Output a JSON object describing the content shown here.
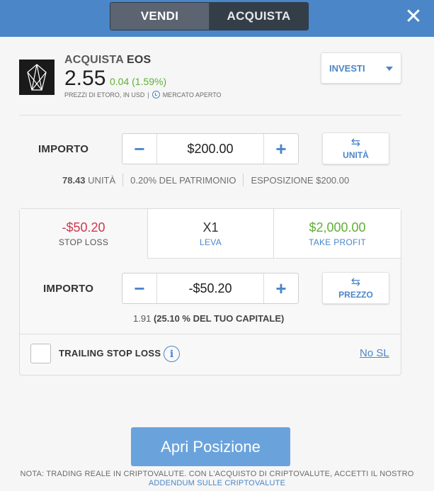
{
  "header": {
    "sell_label": "VENDI",
    "buy_label": "ACQUISTA",
    "close_icon": "close-icon",
    "colors": {
      "bar": "#4a86c8",
      "toggle_active": "#5b6470",
      "toggle_inactive": "#343e49"
    }
  },
  "asset": {
    "action": "ACQUISTA",
    "symbol": "EOS",
    "price": "2.55",
    "change": "0.04 (1.59%)",
    "prices_note": "PREZZI DI ETORO, IN USD",
    "market_status": "MERCATO APERTO",
    "logo_icon": "eos-logo-icon"
  },
  "investi": {
    "label": "INVESTI"
  },
  "amount": {
    "label": "IMPORTO",
    "value": "$200.00",
    "unit_toggle_label": "UNITÀ",
    "units": "78.43",
    "units_label": "UNITÀ",
    "equity": "0.20% DEL PATRIMONIO",
    "exposure_label": "ESPOSIZIONE",
    "exposure_value": "$200.00"
  },
  "tabs": [
    {
      "value": "-$50.20",
      "label": "STOP LOSS"
    },
    {
      "value": "X1",
      "label": "LEVA"
    },
    {
      "value": "$2,000.00",
      "label": "TAKE PROFIT"
    }
  ],
  "stop_loss": {
    "label": "IMPORTO",
    "value": "-$50.20",
    "price_toggle_label": "PREZZO",
    "info_value": "1.91",
    "info_pct": "(25.10 % DEL TUO CAPITALE)",
    "trailing_label": "TRAILING STOP LOSS",
    "no_sl_label": "No SL"
  },
  "open_button": {
    "label": "Apri Posizione",
    "color": "#6aa3dc"
  },
  "footer": {
    "note": "NOTA: TRADING REALE IN CRIPTOVALUTE. CON L'ACQUISTO DI CRIPTOVALUTE, ACCETTI IL NOSTRO",
    "link": "ADDENDUM SULLE CRIPTOVALUTE"
  }
}
